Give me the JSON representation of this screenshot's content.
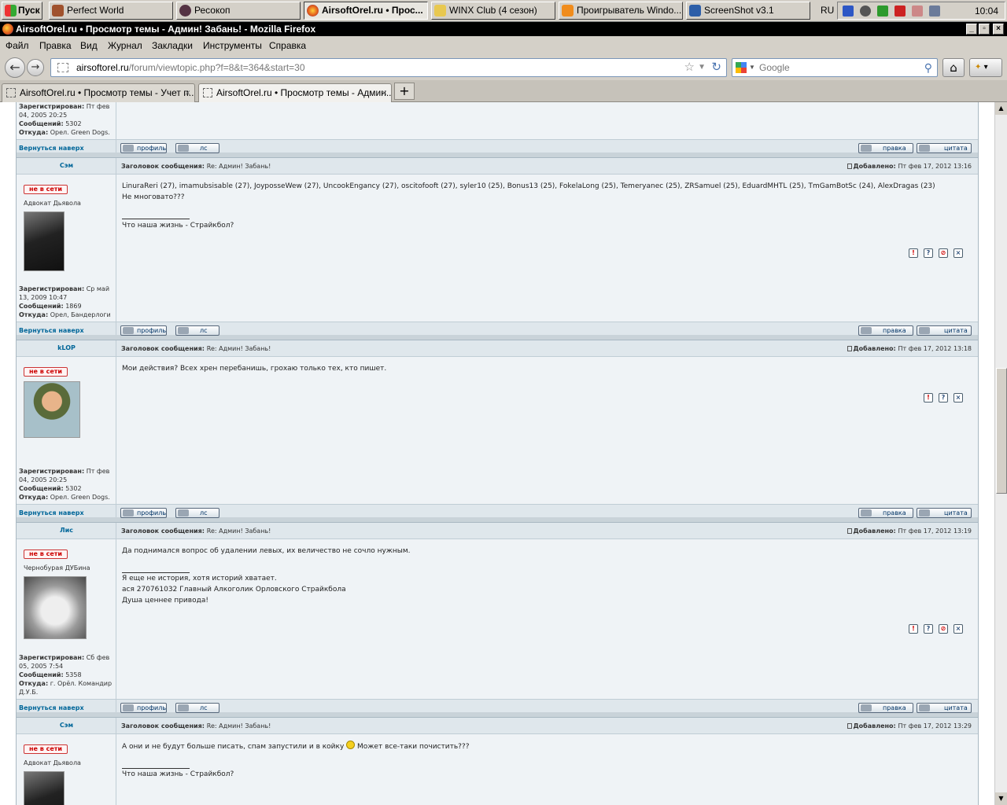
{
  "taskbar": {
    "start": "Пуск",
    "items": [
      {
        "label": "Perfect World",
        "active": false
      },
      {
        "label": "Ресокоп",
        "active": false
      },
      {
        "label": "AirsoftOrel.ru • Прос...",
        "active": true
      },
      {
        "label": "WINX Club (4 сезон)",
        "active": false
      },
      {
        "label": "Проигрыватель Windo...",
        "active": false
      },
      {
        "label": "ScreenShot v3.1",
        "active": false
      }
    ],
    "lang": "RU",
    "clock": "10:04"
  },
  "window": {
    "title": "AirsoftOrel.ru • Просмотр темы - Админ! Забань! - Mozilla Firefox"
  },
  "menu": [
    "Файл",
    "Правка",
    "Вид",
    "Журнал",
    "Закладки",
    "Инструменты",
    "Справка"
  ],
  "nav": {
    "url_host": "airsoftorel.ru",
    "url_path": "/forum/viewtopic.php?f=8&t=364&start=30",
    "search_placeholder": "Google"
  },
  "tabs": [
    {
      "label": "AirsoftOrel.ru • Просмотр темы - Учет п...",
      "selected": false
    },
    {
      "label": "AirsoftOrel.ru • Просмотр темы - Админ...",
      "selected": true
    }
  ],
  "labels": {
    "offline": "не в сети",
    "back_to_top": "Вернуться наверх",
    "profile": "профиль",
    "pm": "лс",
    "edit": "правка",
    "quote": "цитата",
    "subject_label": "Заголовок сообщения:",
    "posted_label": "Добавлено:",
    "reg_label": "Зарегистрирован:",
    "posts_label": "Сообщений:",
    "from_label": "Откуда:"
  },
  "first_tail": {
    "reg": "Пт фев 04, 2005 20:25",
    "posts": "5302",
    "from": "Орел. Green Dogs."
  },
  "posts": [
    {
      "author": "Сэм",
      "subject": "Re: Админ! Забань!",
      "date": "Пт фев 17, 2012 13:16",
      "rank": "Адвокат Дьявола",
      "lines": [
        "LinuraReri (27), imamubsisable (27), JoyposseWew (27), UncookEngancy (27), oscitofooft (27), syler10 (25), Bonus13 (25), FokelaLong (25), Temeryanec (25), ZRSamuel (25), EduardMHTL (25), TmGamBotSc (24), AlexDragas (23)",
        "Не многовато???"
      ],
      "sig": [
        "Что наша жизнь - Страйкбол?"
      ],
      "reg": "Ср май 13, 2009 10:47",
      "postcount": "1869",
      "from": "Орел, Бандерлоги"
    },
    {
      "author": "kLOP",
      "subject": "Re: Админ! Забань!",
      "date": "Пт фев 17, 2012 13:18",
      "rank": "",
      "lines": [
        "Мои действия? Всех хрен перебанишь, грохаю только тех, кто пишет."
      ],
      "sig": [],
      "reg": "Пт фев 04, 2005 20:25",
      "postcount": "5302",
      "from": "Орел. Green Dogs."
    },
    {
      "author": "Лис",
      "subject": "Re: Админ! Забань!",
      "date": "Пт фев 17, 2012 13:19",
      "rank": "Чернобурая ДУБина",
      "lines": [
        "Да поднимался вопрос об удалении левых, их величество не сочло нужным."
      ],
      "sig": [
        "Я еще не история, хотя историй хватает.",
        "ася 270761032 Главный Алкоголик Орловского Страйкбола",
        "Душа ценнее привода!"
      ],
      "reg": "Сб фев 05, 2005 7:54",
      "postcount": "5358",
      "from": "г. Орёл. Командир Д.У.Б."
    },
    {
      "author": "Сэм",
      "subject": "Re: Админ! Забань!",
      "date": "Пт фев 17, 2012 13:29",
      "rank": "Адвокат Дьявола",
      "lines": [
        "А они и не будут больше писать, спам запустили и в койку",
        "Может все-таки почистить???"
      ],
      "sig": [
        "Что наша жизнь - Страйкбол?"
      ]
    }
  ],
  "icons": [
    "red-exclamation-icon",
    "question-icon",
    "ban-icon",
    "delete-icon"
  ]
}
